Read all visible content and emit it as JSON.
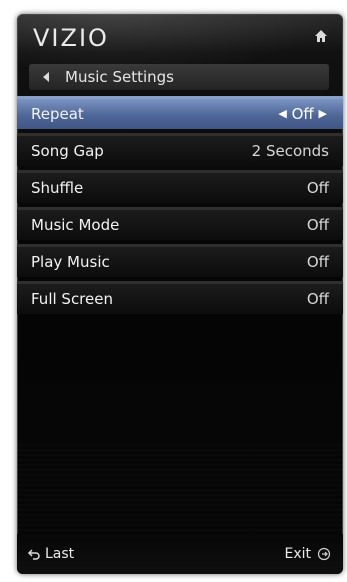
{
  "header": {
    "brand": "VIZIO",
    "home_icon": "home-icon"
  },
  "breadcrumb": {
    "back_icon": "back-arrow-icon",
    "title": "Music Settings"
  },
  "menu": {
    "items": [
      {
        "label": "Repeat",
        "value": "Off",
        "selected": true
      },
      {
        "label": "Song Gap",
        "value": "2 Seconds",
        "selected": false
      },
      {
        "label": "Shuffle",
        "value": "Off",
        "selected": false
      },
      {
        "label": "Music Mode",
        "value": "Off",
        "selected": false
      },
      {
        "label": "Play Music",
        "value": "Off",
        "selected": false
      },
      {
        "label": "Full Screen",
        "value": "Off",
        "selected": false
      }
    ]
  },
  "footer": {
    "last_label": "Last",
    "last_icon": "return-icon",
    "exit_label": "Exit",
    "exit_icon": "exit-icon"
  },
  "colors": {
    "selected_row": "#5b73a6",
    "panel_bg": "#050505",
    "text": "#f2f2f2"
  }
}
